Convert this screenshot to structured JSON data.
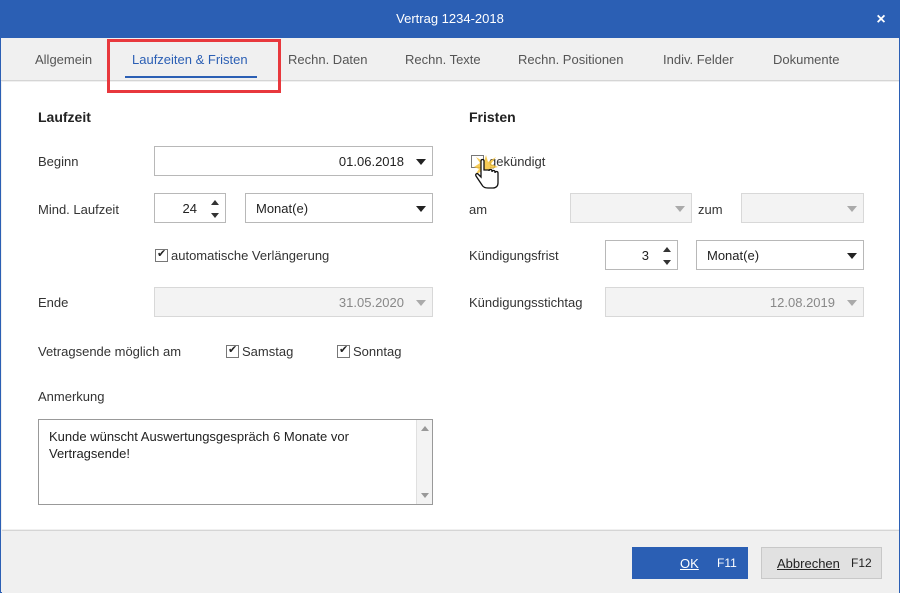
{
  "window": {
    "title": "Vertrag 1234-2018",
    "close_label": "×"
  },
  "tabs": [
    {
      "label": "Allgemein"
    },
    {
      "label": "Laufzeiten & Fristen"
    },
    {
      "label": "Rechn. Daten"
    },
    {
      "label": "Rechn. Texte"
    },
    {
      "label": "Rechn. Positionen"
    },
    {
      "label": "Indiv. Felder"
    },
    {
      "label": "Dokumente"
    }
  ],
  "active_tab": "Laufzeiten & Fristen",
  "laufzeit": {
    "title": "Laufzeit",
    "beginn_label": "Beginn",
    "beginn_value": "01.06.2018",
    "mind_label": "Mind. Laufzeit",
    "mind_value": "24",
    "mind_unit": "Monat(e)",
    "auto_label": "automatische Verlängerung",
    "auto_checked": true,
    "ende_label": "Ende",
    "ende_value": "31.05.2020",
    "vertragsende_label": "Vetragsende möglich am",
    "samstag_label": "Samstag",
    "samstag_checked": true,
    "sonntag_label": "Sonntag",
    "sonntag_checked": true,
    "anmerkung_label": "Anmerkung",
    "anmerkung_text": "Kunde wünscht Auswertungsgespräch 6 Monate vor Vertragsende!"
  },
  "fristen": {
    "title": "Fristen",
    "gekuendigt_label": "gekündigt",
    "gekuendigt_checked": false,
    "am_label": "am",
    "am_value": "",
    "zum_label": "zum",
    "zum_value": "",
    "frist_label": "Kündigungsfrist",
    "frist_value": "3",
    "frist_unit": "Monat(e)",
    "stichtag_label": "Kündigungsstichtag",
    "stichtag_value": "12.08.2019"
  },
  "footer": {
    "ok_label": "OK",
    "ok_key": "F11",
    "cancel_label": "Abbrechen",
    "cancel_key": "F12"
  },
  "colors": {
    "accent": "#2b5fb4",
    "highlight": "#e8383d"
  }
}
